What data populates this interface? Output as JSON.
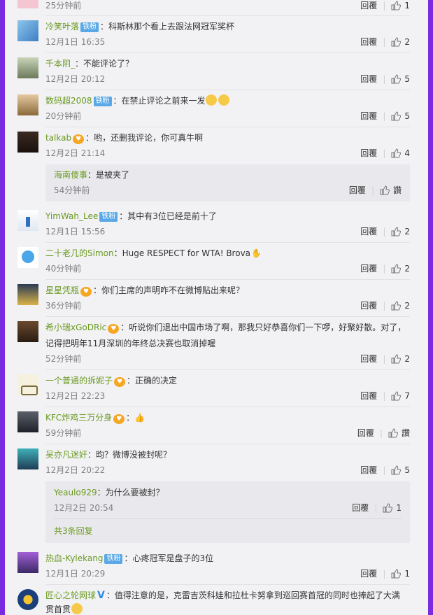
{
  "actions": {
    "reply": "回覆",
    "like_placeholder": "讚"
  },
  "comments": [
    {
      "time": "25分钟前",
      "likes": "1"
    },
    {
      "user": "冷笑叶落",
      "badge": "铁粉",
      "text": "：科斯林那个看上去跟法网冠军奖杯",
      "time": "12月1日 16:35",
      "likes": "2"
    },
    {
      "user": "千本阴_",
      "text": "：不能评论了？",
      "time": "12月2日 20:12",
      "likes": "5"
    },
    {
      "user": "数码超2008",
      "badge": "铁粉",
      "text": "：在禁止评论之前来一发",
      "time": "20分钟前",
      "likes": "5"
    },
    {
      "user": "talkab",
      "text": "：哟，还删我评论，你可真牛啊",
      "time": "12月2日 21:14",
      "likes": "4",
      "reply": {
        "user": "海南傻事",
        "text": "：是被夹了",
        "time": "54分钟前"
      }
    },
    {
      "user": "YimWah_Lee",
      "badge": "铁粉",
      "text": "：其中有3位已经是前十了",
      "time": "12月1日 15:56",
      "likes": "2"
    },
    {
      "user": "二十老几的Simon",
      "text": "：Huge RESPECT for WTA! Brova",
      "time": "40分钟前",
      "likes": "2"
    },
    {
      "user": "星星凭瓶",
      "text": "：你们主席的声明咋不在微博贴出来呢？",
      "time": "36分钟前",
      "likes": "2"
    },
    {
      "user": "希小瑞xGoDRic",
      "text": "：听说你们退出中国市场了啊，那我只好恭喜你们一下啰，好聚好散。对了，",
      "text2": "记得把明年11月深圳的年终总决赛也取消掉喔",
      "time": "52分钟前",
      "likes": "2"
    },
    {
      "user": "一个普通的拆妮子",
      "text": "：正确的决定",
      "time": "12月2日 22:23",
      "likes": "7"
    },
    {
      "user": "KFC炸鸡三万分身",
      "text": "：",
      "time": "59分钟前"
    },
    {
      "user": "吴亦凡迷奸",
      "text": "：昀？微博没被封呢？",
      "time": "12月2日 20:22",
      "likes": "5",
      "reply": {
        "user": "Yeaulo929",
        "text": "：为什么要被封？",
        "time": "12月2日 20:54",
        "likes": "1",
        "more": "共3条回复"
      }
    },
    {
      "user": "热血-Kylekang",
      "badge": "铁粉",
      "text": "：心疼冠军是盘子的3位",
      "time": "12月1日 20:29",
      "likes": "1"
    },
    {
      "user": "匠心之轮网球",
      "text": "：值得注意的是，克雷吉茨科娃和拉杜卡努拿到巡回赛首冠的同时也捧起了大满",
      "text2": "贯首贯"
    }
  ]
}
